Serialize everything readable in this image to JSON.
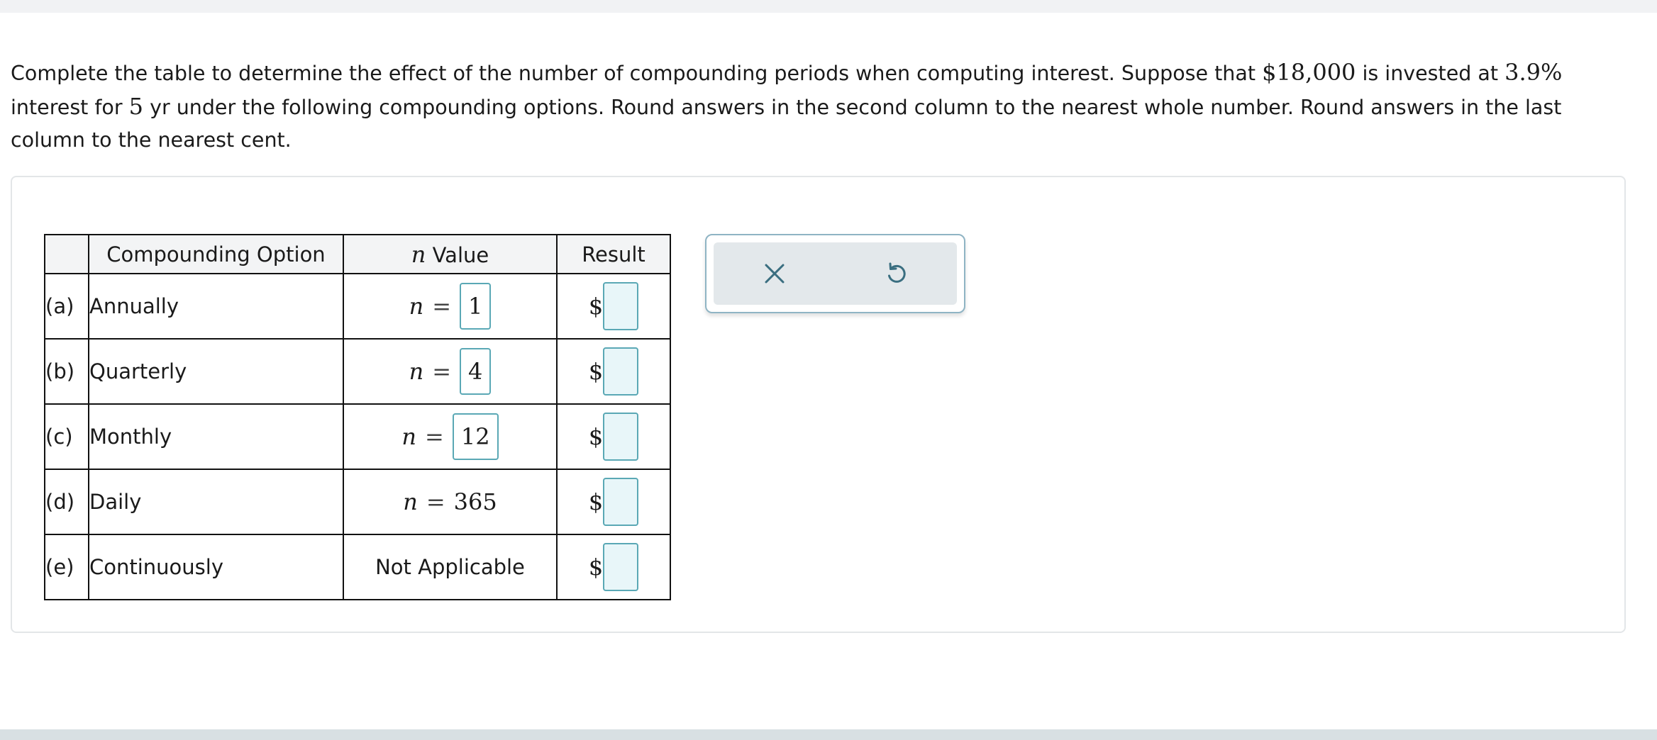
{
  "prompt": {
    "p1": "Complete the table to determine the effect of the number of compounding periods when computing interest. Suppose that ",
    "principal": "$18,000",
    "p2": " is invested at ",
    "rate": "3.9%",
    "p3": " interest for ",
    "years": "5",
    "p4": " yr under the following compounding options. Round answers in the second column to the nearest whole number. Round answers in the last column to the nearest cent."
  },
  "table": {
    "headers": {
      "option": "Compounding Option",
      "n_var": "n",
      "n_label": " Value",
      "result": "Result"
    },
    "rows": [
      {
        "letter": "(a)",
        "option": "Annually",
        "n_var": "n",
        "eq": "=",
        "n_value": "1",
        "currency": "$",
        "result": ""
      },
      {
        "letter": "(b)",
        "option": "Quarterly",
        "n_var": "n",
        "eq": "=",
        "n_value": "4",
        "currency": "$",
        "result": ""
      },
      {
        "letter": "(c)",
        "option": "Monthly",
        "n_var": "n",
        "eq": "=",
        "n_value": "12",
        "currency": "$",
        "result": ""
      },
      {
        "letter": "(d)",
        "option": "Daily",
        "n_var": "n",
        "eq": "=",
        "n_value": "365",
        "currency": "$",
        "result": ""
      },
      {
        "letter": "(e)",
        "option": "Continuously",
        "n_text": "Not Applicable",
        "currency": "$",
        "result": ""
      }
    ]
  },
  "actions": {
    "clear_icon": "close-icon",
    "reset_icon": "undo-icon"
  },
  "colors": {
    "input_border": "#5aa8b5",
    "input_fill": "#e8f6f9",
    "action_bg": "#e3e8eb",
    "icon": "#3a6e80"
  }
}
